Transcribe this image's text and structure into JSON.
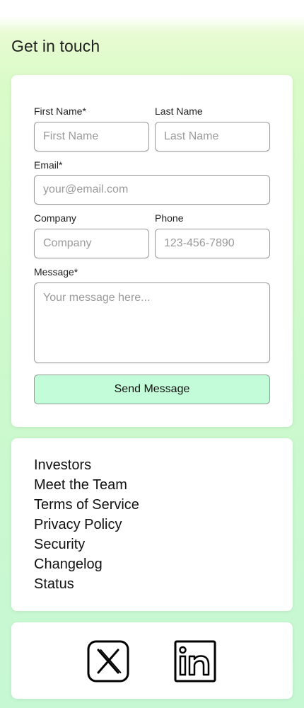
{
  "page": {
    "title": "Get in touch"
  },
  "form": {
    "first_name": {
      "label": "First Name*",
      "placeholder": "First Name"
    },
    "last_name": {
      "label": "Last Name",
      "placeholder": "Last Name"
    },
    "email": {
      "label": "Email*",
      "placeholder": "your@email.com"
    },
    "company": {
      "label": "Company",
      "placeholder": "Company"
    },
    "phone": {
      "label": "Phone",
      "placeholder": "123-456-7890"
    },
    "message": {
      "label": "Message*",
      "placeholder": "Your message here..."
    },
    "submit_label": "Send Message"
  },
  "links": [
    "Investors",
    "Meet the Team",
    "Terms of Service",
    "Privacy Policy",
    "Security",
    "Changelog",
    "Status"
  ],
  "social": {
    "icons": [
      "x-icon",
      "linkedin-icon"
    ]
  },
  "colors": {
    "button_bg": "#c3fcd8",
    "background_top": "#e8fbd2",
    "background_bottom": "#c6f8d4"
  }
}
